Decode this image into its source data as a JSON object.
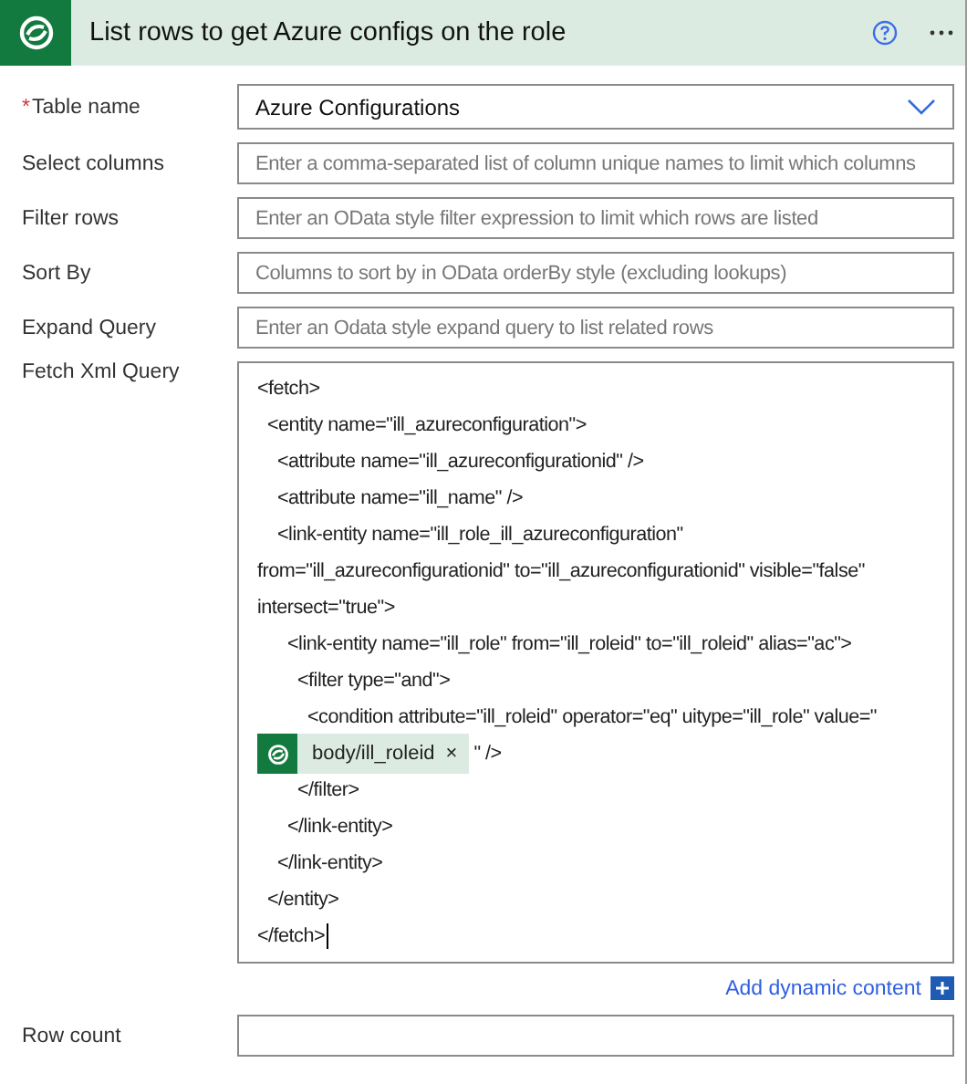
{
  "header": {
    "title": "List rows to get Azure configs on the role"
  },
  "fields": [
    {
      "label": "Table name",
      "required_mark": "*",
      "kind": "dropdown",
      "value": "Azure Configurations"
    },
    {
      "label": "Select columns",
      "kind": "text",
      "placeholder": "Enter a comma-separated list of column unique names to limit which columns"
    },
    {
      "label": "Filter rows",
      "kind": "text",
      "placeholder": "Enter an OData style filter expression to limit which rows are listed"
    },
    {
      "label": "Sort By",
      "kind": "text",
      "placeholder": "Columns to sort by in OData orderBy style (excluding lookups)"
    },
    {
      "label": "Expand Query",
      "kind": "text",
      "placeholder": "Enter an Odata style expand query to list related rows"
    }
  ],
  "fetch_xml": {
    "label": "Fetch Xml Query",
    "lines": [
      {
        "kind": "text",
        "text": "<fetch>"
      },
      {
        "kind": "text",
        "text": "  <entity name=\"ill_azureconfiguration\">"
      },
      {
        "kind": "text",
        "text": "    <attribute name=\"ill_azureconfigurationid\" />"
      },
      {
        "kind": "text",
        "text": "    <attribute name=\"ill_name\" />"
      },
      {
        "kind": "text",
        "text": "    <link-entity name=\"ill_role_ill_azureconfiguration\""
      },
      {
        "kind": "text",
        "text": "from=\"ill_azureconfigurationid\" to=\"ill_azureconfigurationid\" visible=\"false\""
      },
      {
        "kind": "text",
        "text": "intersect=\"true\">"
      },
      {
        "kind": "text",
        "text": "      <link-entity name=\"ill_role\" from=\"ill_roleid\" to=\"ill_roleid\" alias=\"ac\">"
      },
      {
        "kind": "text",
        "text": "        <filter type=\"and\">"
      },
      {
        "kind": "text",
        "text": "          <condition attribute=\"ill_roleid\" operator=\"eq\" uitype=\"ill_role\" value=\""
      },
      {
        "kind": "token",
        "token": "body/ill_roleid",
        "remove": "×",
        "text": "\" />"
      },
      {
        "kind": "text",
        "text": "        </filter>"
      },
      {
        "kind": "text",
        "text": "      </link-entity>"
      },
      {
        "kind": "text",
        "text": "    </link-entity>"
      },
      {
        "kind": "text",
        "text": "  </entity>"
      },
      {
        "kind": "text",
        "text": "</fetch>",
        "cursor": true
      }
    ]
  },
  "add_dynamic": "Add dynamic content",
  "next_field": {
    "label": "Row count"
  }
}
